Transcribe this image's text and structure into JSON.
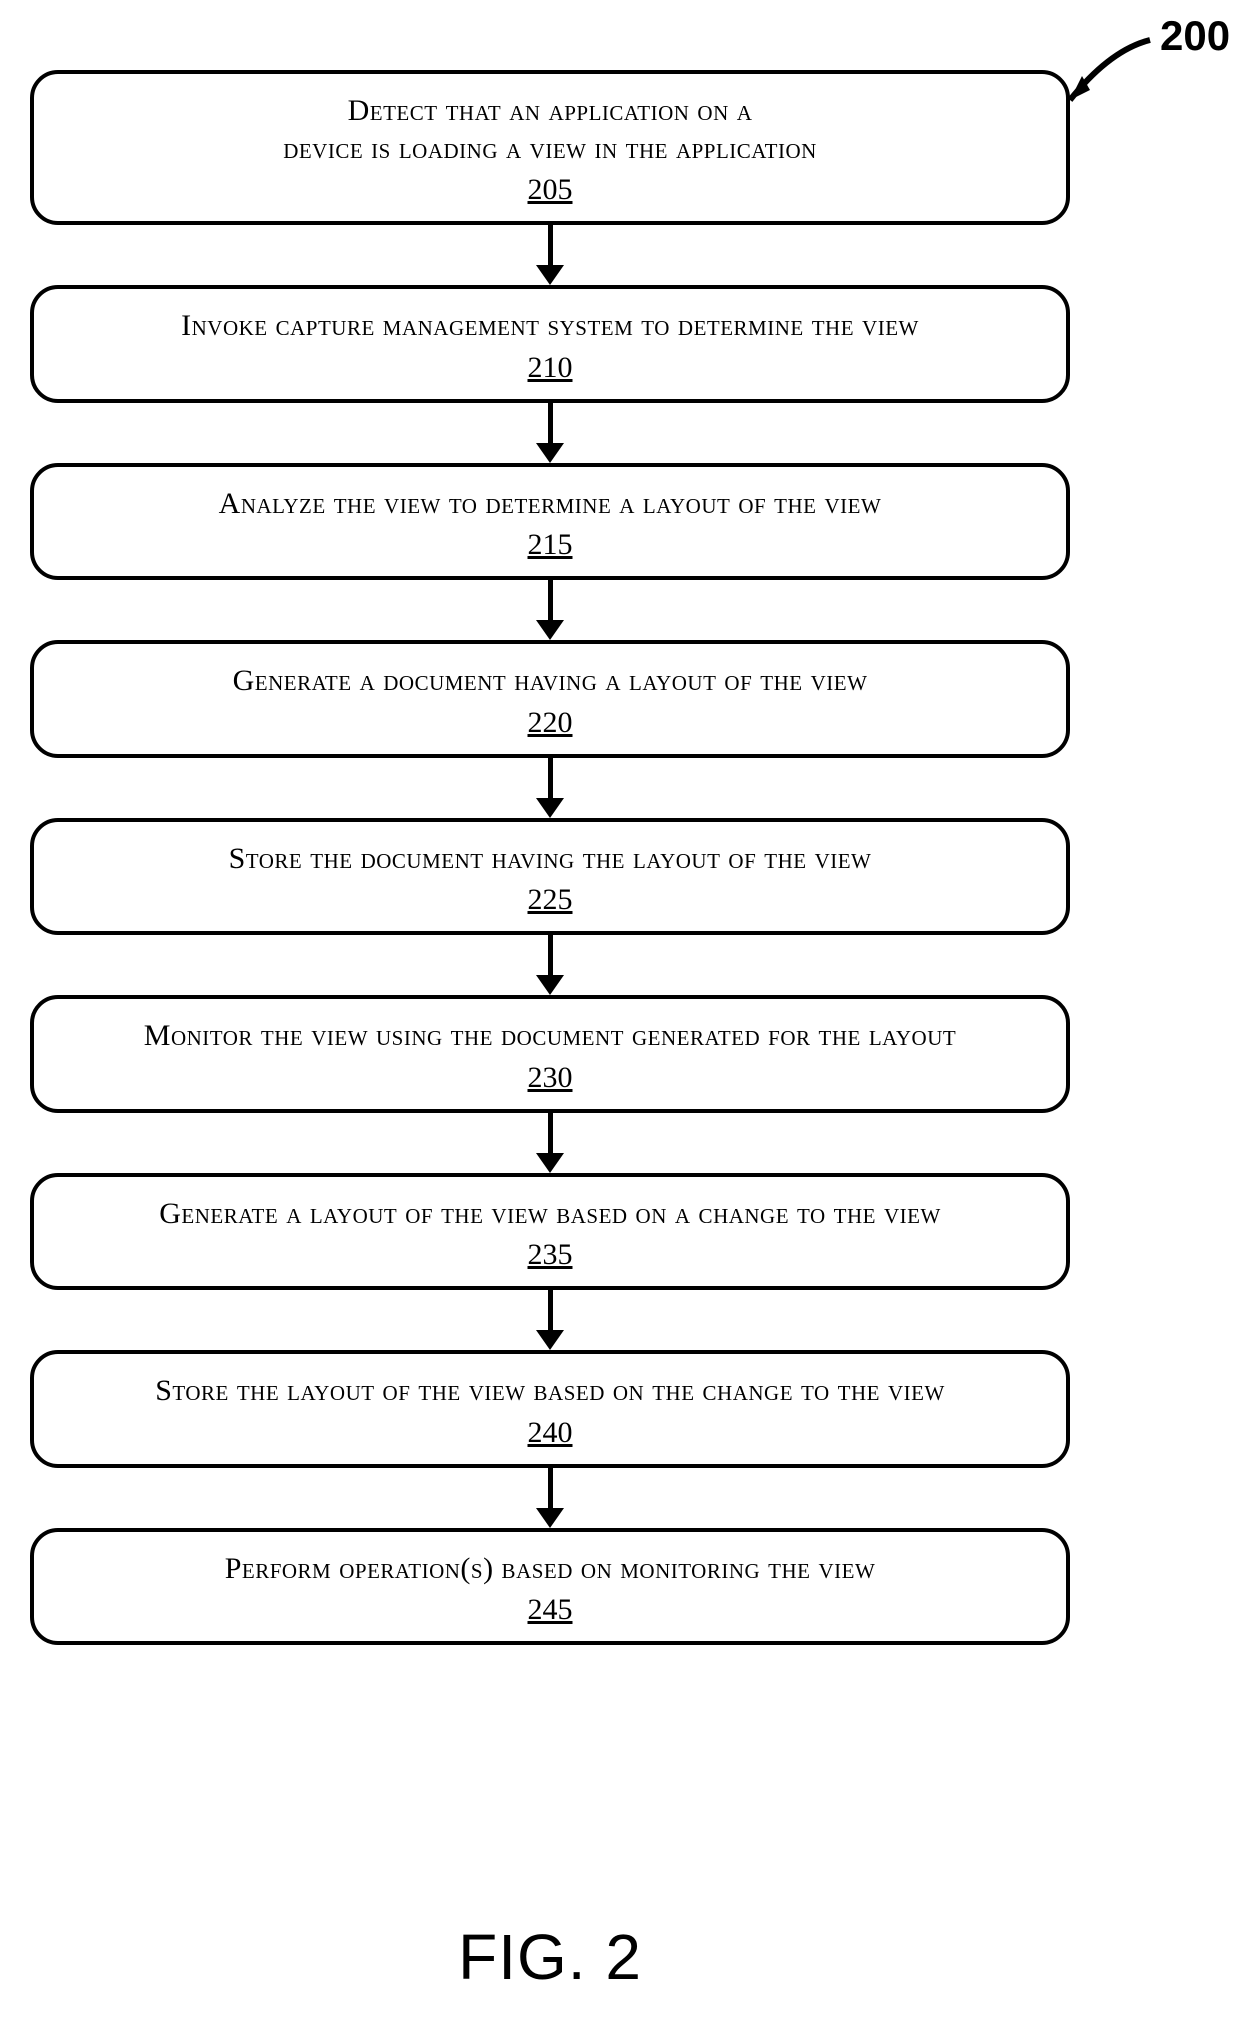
{
  "figure": {
    "ref_label": "200",
    "caption": "FIG. 2"
  },
  "steps": [
    {
      "text": "Detect that an application on a\ndevice is loading a view in the application",
      "num": "205"
    },
    {
      "text": "Invoke capture management system to determine the view",
      "num": "210"
    },
    {
      "text": "Analyze the view to determine a layout of the view",
      "num": "215"
    },
    {
      "text": "Generate a document having a layout of the view",
      "num": "220"
    },
    {
      "text": "Store the document having the layout of the view",
      "num": "225"
    },
    {
      "text": "Monitor the view using the document generated for the layout",
      "num": "230"
    },
    {
      "text": "Generate a layout of the view based on a change to the view",
      "num": "235"
    },
    {
      "text": "Store the layout of the view based on the change to the view",
      "num": "240"
    },
    {
      "text": "Perform operation(s) based on monitoring the view",
      "num": "245"
    }
  ]
}
